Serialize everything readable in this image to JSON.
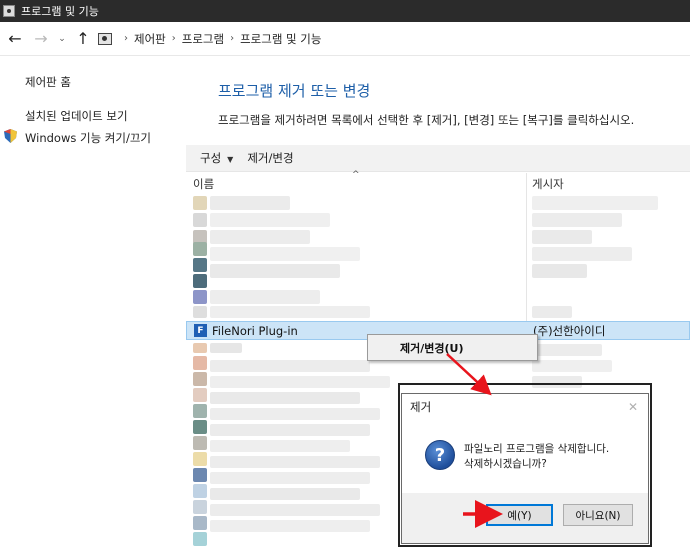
{
  "window": {
    "title": "프로그램 및 기능"
  },
  "breadcrumb": {
    "items": [
      "제어판",
      "프로그램",
      "프로그램 및 기능"
    ]
  },
  "sidebar": {
    "items": [
      {
        "label": "제어판 홈"
      },
      {
        "label": "설치된 업데이트 보기"
      },
      {
        "label": "Windows 기능 켜기/끄기"
      }
    ]
  },
  "main": {
    "heading": "프로그램 제거 또는 변경",
    "description": "프로그램을 제거하려면 목록에서 선택한 후 [제거], [변경] 또는 [복구]를 클릭하십시오."
  },
  "toolbar": {
    "organize_label": "구성",
    "uninstall_change_label": "제거/변경"
  },
  "table": {
    "columns": [
      "이름",
      "게시자"
    ],
    "selected_row": {
      "name": "FileNori Plug-in",
      "publisher": "(주)선한아이디",
      "icon_letter": "F"
    }
  },
  "context_menu": {
    "item_label": "제거/변경(U)"
  },
  "dialog": {
    "title": "제거",
    "close_glyph": "✕",
    "message_line1": "파일노리 프로그램을 삭제합니다.",
    "message_line2": "삭제하시겠습니까?",
    "icon_glyph": "?",
    "yes_label": "예(Y)",
    "no_label": "아니요(N)"
  },
  "colors": {
    "heading_blue": "#1e5fa8",
    "selection": "#cce4f7",
    "annotation_red": "#e8141c"
  }
}
